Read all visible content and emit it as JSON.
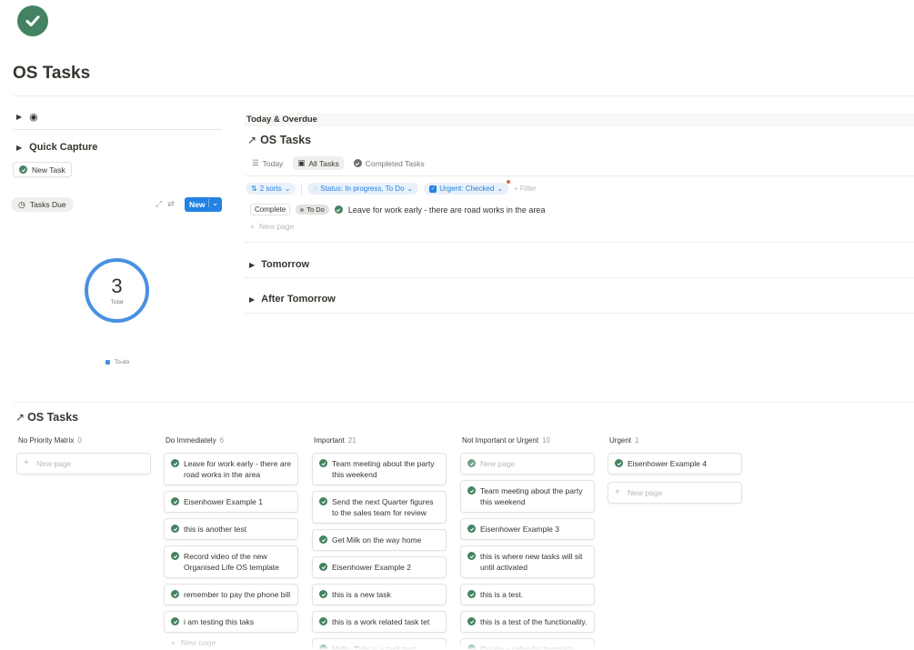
{
  "page": {
    "title": "OS Tasks"
  },
  "left": {
    "quick_capture": {
      "title": "Quick Capture",
      "new_task_label": "New Task"
    },
    "tasks_due": {
      "tab_label": "Tasks Due",
      "new_label": "New",
      "total_value": "3",
      "total_label": "Total",
      "legend_label": "To-do"
    }
  },
  "today": {
    "section_title": "Today & Overdue",
    "db_title": "OS Tasks",
    "views": [
      {
        "label": "Today",
        "icon": "list-icon"
      },
      {
        "label": "All Tasks",
        "icon": "database-icon"
      },
      {
        "label": "Completed Tasks",
        "icon": "check-circle-icon"
      }
    ],
    "filters": {
      "sorts": "2 sorts",
      "status": "Status: In progress, To Do",
      "urgent": "Urgent: Checked",
      "add": "Filter"
    },
    "row": {
      "complete_label": "Complete",
      "status_tag": "To Do",
      "task": "Leave for work early - there are road works in the area"
    },
    "new_page": "New page",
    "sections": [
      "Tomorrow",
      "After Tomorrow"
    ]
  },
  "board": {
    "title": "OS Tasks",
    "columns": [
      {
        "name": "No Priority Matrix",
        "count": "0",
        "cards": [],
        "new_page": "New page"
      },
      {
        "name": "Do Immediately",
        "count": "6",
        "cards": [
          "Leave for work early - there are road works in the area",
          "Eisenhower Example 1",
          "this is another test",
          "Record video of the new Organised Life OS template",
          "remember to pay the phone bill",
          "i am testing this taks"
        ],
        "new_page": "New page"
      },
      {
        "name": "Important",
        "count": "21",
        "cards": [
          "Team meeting about the party this weekend",
          "Send the next Quarter figures to the sales team for review",
          "Get Milk on the way home",
          "Eisenhower Example 2",
          "this is a new task",
          "this is a work related task tet",
          "Hello, Thjis is a task test"
        ]
      },
      {
        "name": "Not Important or Urgent",
        "count": "10",
        "cards": [
          "New page",
          "Team meeting about the party this weekend",
          "Eisenhower Example 3",
          "this is where new tasks will sit until activated",
          "this is a test.",
          "this is a test of the functionality.",
          "Create a calendar template"
        ]
      },
      {
        "name": "Urgent",
        "count": "1",
        "cards": [
          "Eisenhower Example 4"
        ],
        "new_page": "New page"
      }
    ]
  },
  "colors": {
    "accent": "#2383e2",
    "check": "#448361",
    "donut": "#4a90e2"
  }
}
